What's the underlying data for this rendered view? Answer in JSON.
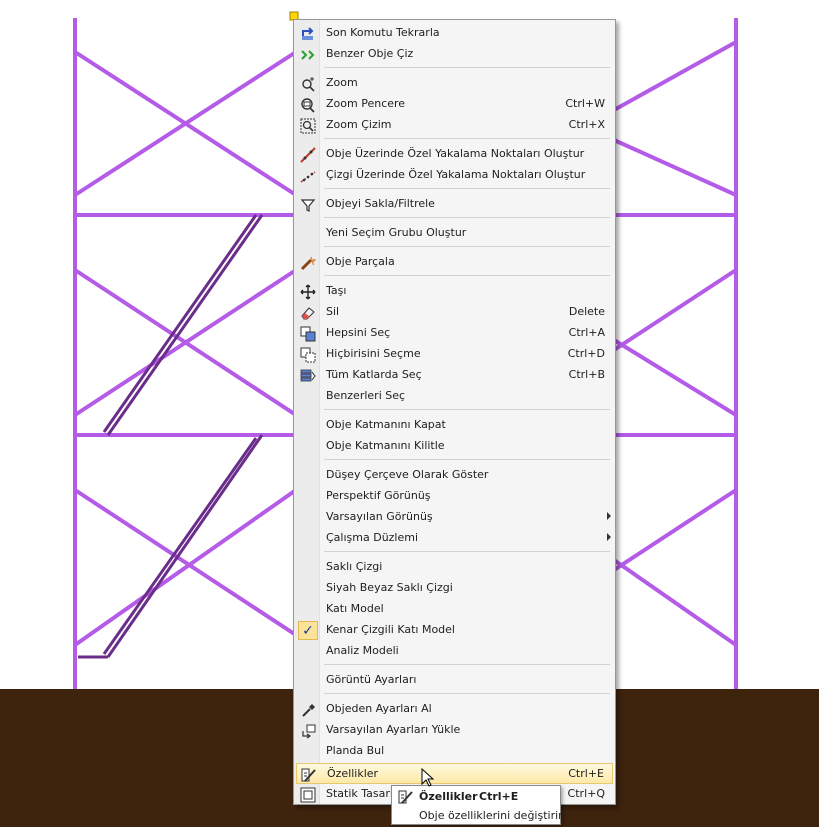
{
  "colors": {
    "frame": "#b45be8",
    "frame_dark": "#6a2e8a",
    "ground": "#3e230d",
    "highlight": "#fde9a6"
  },
  "menu": {
    "items": [
      {
        "label": "Son Komutu Tekrarla",
        "icon": "repeat-command-icon"
      },
      {
        "label": "Benzer Obje Çiz",
        "icon": "similar-object-icon"
      },
      {
        "label": "Zoom",
        "icon": "zoom-icon"
      },
      {
        "label": "Zoom Pencere",
        "shortcut": "Ctrl+W",
        "icon": "zoom-window-icon"
      },
      {
        "label": "Zoom Çizim",
        "shortcut": "Ctrl+X",
        "icon": "zoom-drawing-icon"
      },
      {
        "label": "Obje Üzerinde Özel Yakalama Noktaları Oluştur",
        "icon": "object-snap-icon"
      },
      {
        "label": "Çizgi Üzerinde Özel Yakalama Noktaları Oluştur",
        "icon": "line-snap-icon"
      },
      {
        "label": "Objeyi Sakla/Filtrele",
        "icon": "filter-icon"
      },
      {
        "label": "Yeni Seçim Grubu Oluştur"
      },
      {
        "label": "Obje Parçala",
        "icon": "explode-icon"
      },
      {
        "label": "Taşı",
        "icon": "move-icon"
      },
      {
        "label": "Sil",
        "shortcut": "Delete",
        "icon": "eraser-icon"
      },
      {
        "label": "Hepsini Seç",
        "shortcut": "Ctrl+A",
        "icon": "select-all-icon"
      },
      {
        "label": "Hiçbirisini Seçme",
        "shortcut": "Ctrl+D",
        "icon": "select-none-icon"
      },
      {
        "label": "Tüm Katlarda Seç",
        "shortcut": "Ctrl+B",
        "icon": "select-all-floors-icon"
      },
      {
        "label": "Benzerleri Seç"
      },
      {
        "label": "Obje Katmanını Kapat"
      },
      {
        "label": "Obje Katmanını Kilitle"
      },
      {
        "label": "Düşey Çerçeve Olarak Göster"
      },
      {
        "label": "Perspektif Görünüş"
      },
      {
        "label": "Varsayılan Görünüş"
      },
      {
        "label": "Çalışma Düzlemi"
      },
      {
        "label": "Saklı Çizgi"
      },
      {
        "label": "Siyah Beyaz Saklı Çizgi"
      },
      {
        "label": "Katı Model"
      },
      {
        "label": "Kenar Çizgili Katı Model",
        "icon": "check-icon",
        "check": "✓"
      },
      {
        "label": "Analiz Modeli"
      },
      {
        "label": "Görüntü Ayarları"
      },
      {
        "label": "Objeden Ayarları Al",
        "icon": "eyedropper-icon"
      },
      {
        "label": "Varsayılan Ayarları Yükle",
        "icon": "load-defaults-icon"
      },
      {
        "label": "Planda Bul"
      },
      {
        "label": "Özellikler",
        "shortcut": "Ctrl+E",
        "icon": "properties-icon"
      },
      {
        "label": "Statik Tasarım",
        "shortcut": "Ctrl+Q",
        "icon": "static-design-icon"
      }
    ]
  },
  "tooltip": {
    "title": "Özellikler",
    "shortcut": "Ctrl+E",
    "description": "Obje özelliklerini değiştirir."
  }
}
